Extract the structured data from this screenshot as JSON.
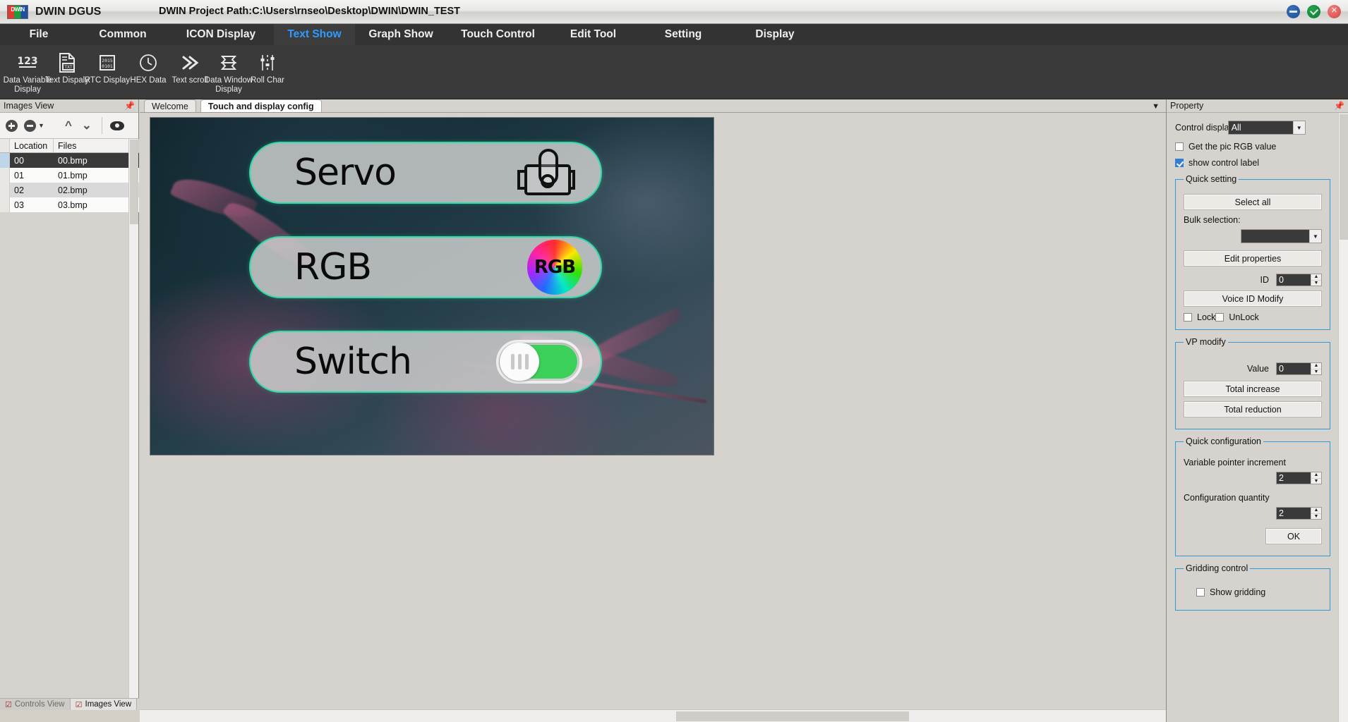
{
  "titlebar": {
    "app_name": "DWIN DGUS",
    "logo": "dwin-logo",
    "project_path": "DWIN Project Path:C:\\Users\\rnseo\\Desktop\\DWIN\\DWIN_TEST",
    "window_buttons": [
      {
        "name": "minimize-button",
        "glyph": "minimize-icon"
      },
      {
        "name": "maximize-button",
        "glyph": "maximize-icon"
      },
      {
        "name": "close-button",
        "glyph": "close-icon"
      }
    ]
  },
  "menubar": {
    "items": [
      {
        "label": "File",
        "active": false
      },
      {
        "label": "Common",
        "active": false
      },
      {
        "label": "ICON Display",
        "active": false
      },
      {
        "label": "Text Show",
        "active": true
      },
      {
        "label": "Graph Show",
        "active": false
      },
      {
        "label": "Touch Control",
        "active": false
      },
      {
        "label": "Edit Tool",
        "active": false
      },
      {
        "label": "Setting",
        "active": false
      },
      {
        "label": "Display",
        "active": false
      }
    ]
  },
  "ribbon": {
    "buttons": [
      {
        "label": "Data Variable Display",
        "icon": "123-number-icon"
      },
      {
        "label": "Text Dispaly",
        "icon": "text-document-icon"
      },
      {
        "label": "RTC Display",
        "icon": "calendar-rtc-icon"
      },
      {
        "label": "HEX Data",
        "icon": "clock-icon"
      },
      {
        "label": "Text scroll",
        "icon": "double-chevron-right-icon"
      },
      {
        "label": "Data Window Display",
        "icon": "data-window-icon"
      },
      {
        "label": "Roll Char",
        "icon": "sliders-icon"
      }
    ]
  },
  "left_panel": {
    "title": "Images View",
    "pin_icon": "pin-icon",
    "toolbar": [
      {
        "name": "add-image-button",
        "icon": "plus-circle-icon"
      },
      {
        "name": "remove-image-button",
        "icon": "minus-circle-icon"
      },
      {
        "name": "move-up-button",
        "icon": "chevron-up-icon"
      },
      {
        "name": "move-down-button",
        "icon": "chevron-down-icon"
      },
      {
        "name": "preview-button",
        "icon": "eye-icon"
      }
    ],
    "table": {
      "columns": [
        "Location",
        "Files"
      ],
      "rows": [
        {
          "location": "00",
          "file": "00.bmp",
          "selected": true
        },
        {
          "location": "01",
          "file": "01.bmp",
          "selected": false
        },
        {
          "location": "02",
          "file": "02.bmp",
          "selected": false
        },
        {
          "location": "03",
          "file": "03.bmp",
          "selected": false
        }
      ]
    },
    "bottom_tabs": [
      {
        "label": "Controls View",
        "active": false
      },
      {
        "label": "Images View",
        "active": true
      }
    ]
  },
  "center": {
    "tabs": [
      {
        "label": "Welcome",
        "active": false
      },
      {
        "label": "Touch and display config",
        "active": true
      }
    ],
    "tab_dropdown_icon": "chevron-down-icon",
    "design": {
      "controls": [
        {
          "label": "Servo",
          "icon": "servo-motor-icon"
        },
        {
          "label": "RGB",
          "icon": "rgb-color-wheel-icon"
        },
        {
          "label": "Switch",
          "icon": "toggle-switch-icon"
        }
      ],
      "accent_color": "#2fdba6",
      "toggle_on_color": "#3bd05a"
    }
  },
  "property": {
    "title": "Property",
    "pin_icon": "pin-icon",
    "control_display": {
      "label": "Control display",
      "value": "All"
    },
    "checkboxes": [
      {
        "label": "Get the pic RGB value",
        "checked": false
      },
      {
        "label": "show control label",
        "checked": true
      }
    ],
    "quick_setting": {
      "legend": "Quick setting",
      "select_all": "Select all",
      "bulk_selection_label": "Bulk selection:",
      "bulk_selection_value": "",
      "edit_properties": "Edit properties",
      "id_label": "ID",
      "id_value": "0",
      "voice_id_modify": "Voice ID Modify",
      "lock_label": "Lock",
      "lock_checked": false,
      "unlock_label": "UnLock",
      "unlock_checked": false
    },
    "vp_modify": {
      "legend": "VP modify",
      "value_label": "Value",
      "value": "0",
      "total_increase": "Total increase",
      "total_reduction": "Total reduction"
    },
    "quick_configuration": {
      "legend": "Quick configuration",
      "variable_pointer_increment_label": "Variable pointer increment",
      "variable_pointer_increment": "2",
      "configuration_quantity_label": "Configuration quantity",
      "configuration_quantity": "2",
      "ok": "OK"
    },
    "gridding_control": {
      "legend": "Gridding control",
      "show_gridding_label": "Show gridding",
      "show_gridding_checked": false
    }
  }
}
